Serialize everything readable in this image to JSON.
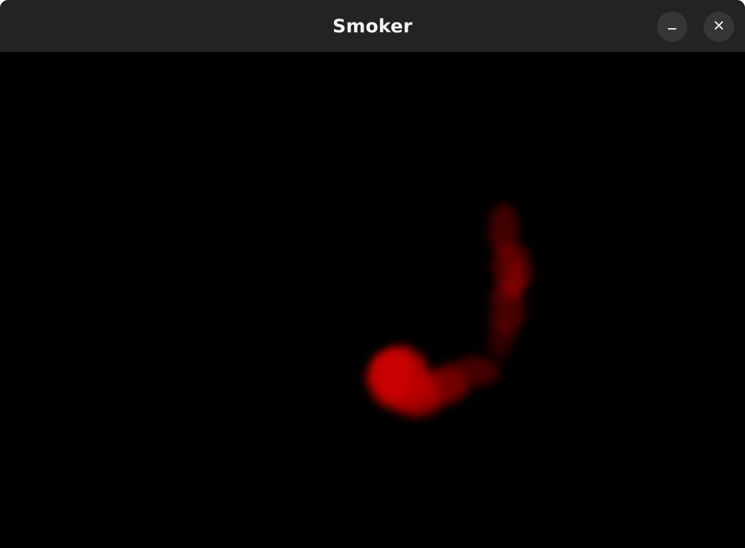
{
  "window": {
    "title": "Smoker"
  },
  "titlebar": {
    "minimize_icon": "minimize-icon",
    "close_icon": "close-icon"
  },
  "canvas": {
    "background_color": "#000000",
    "smoke_color": "#d40000"
  }
}
